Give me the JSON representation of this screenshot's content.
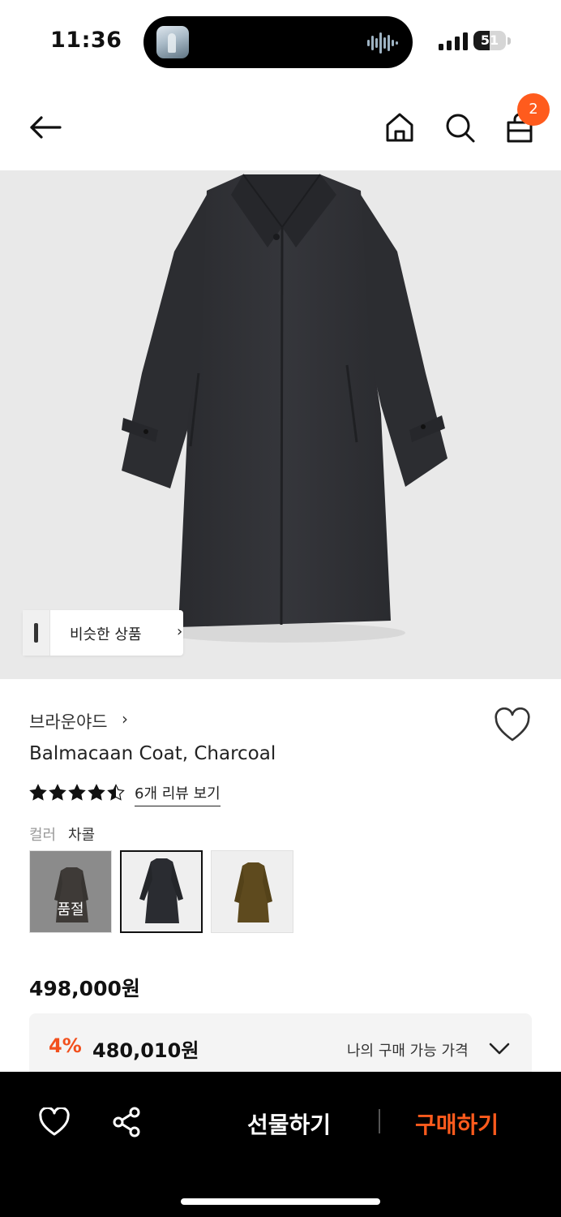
{
  "status_bar": {
    "time": "11:36",
    "battery_percent": "51",
    "battery_level": 0.51
  },
  "nav": {
    "cart_count": "2",
    "badge_color": "#ff5b1d"
  },
  "hero": {
    "similar_label": "비슷한 상품",
    "similar_chevron": "›"
  },
  "product": {
    "brand": "브라운야드",
    "brand_chevron": "›",
    "title": "Balmacaan Coat, Charcoal",
    "rating": 4.5,
    "review_link": "6개 리뷰 보기",
    "color_label": "컬러",
    "color_value": "차콜",
    "swatches": [
      {
        "name": "grey",
        "sold_out": true,
        "sold_out_label": "품절",
        "color": "#6b6560"
      },
      {
        "name": "charcoal",
        "sold_out": false,
        "selected": true,
        "color": "#2a2c31"
      },
      {
        "name": "brown",
        "sold_out": false,
        "color": "#5e4a1e"
      }
    ],
    "price": "498,000원",
    "discount_rate": "4%",
    "discount_price": "480,010원",
    "my_price_label": "나의 구매 가능 가격",
    "accent_color": "#f2501d"
  },
  "bottom_bar": {
    "gift_label": "선물하기",
    "buy_label": "구매하기"
  }
}
